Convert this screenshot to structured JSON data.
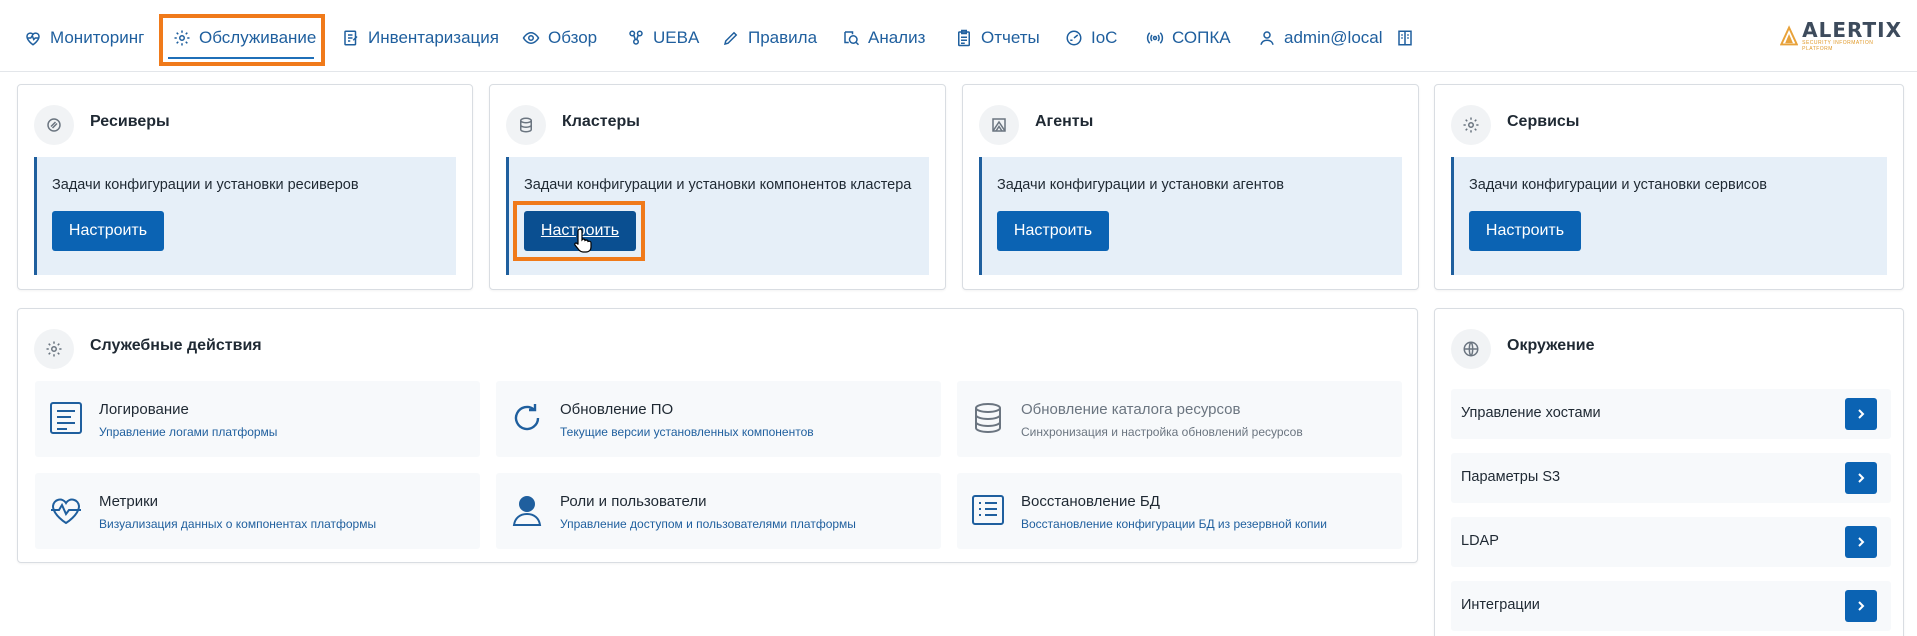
{
  "nav": {
    "items": [
      {
        "label": "Мониторинг",
        "icon": "heart-pulse-icon"
      },
      {
        "label": "Обслуживание",
        "icon": "gear-icon",
        "active": true
      },
      {
        "label": "Инвентаризация",
        "icon": "edit-list-icon"
      },
      {
        "label": "Обзор",
        "icon": "eye-icon"
      },
      {
        "label": "UEBA",
        "icon": "users-network-icon"
      },
      {
        "label": "Правила",
        "icon": "pencil-icon"
      },
      {
        "label": "Анализ",
        "icon": "magnify-analysis-icon"
      },
      {
        "label": "Отчеты",
        "icon": "clipboard-icon"
      },
      {
        "label": "IoC",
        "icon": "shield-gauge-icon"
      },
      {
        "label": "СОПКА",
        "icon": "broadcast-icon"
      },
      {
        "label": "admin@local",
        "icon": "user-icon"
      }
    ],
    "book_icon": "book-icon"
  },
  "logo": {
    "text": "ALERTIX",
    "subtext": "SECURITY INFORMATION PLATFORM",
    "accent": "#e8a23a"
  },
  "top_cards": [
    {
      "title": "Ресиверы",
      "icon": "receiver-icon",
      "description": "Задачи конфигурации и установки ресиверов",
      "button": "Настроить"
    },
    {
      "title": "Кластеры",
      "icon": "database-icon",
      "description": "Задачи конфигурации и установки компонентов кластера",
      "button": "Настроить"
    },
    {
      "title": "Агенты",
      "icon": "agent-icon",
      "description": "Задачи конфигурации и установки агентов",
      "button": "Настроить"
    },
    {
      "title": "Сервисы",
      "icon": "gear-icon",
      "description": "Задачи конфигурации и установки сервисов",
      "button": "Настроить"
    }
  ],
  "service": {
    "title": "Служебные действия",
    "tiles": [
      {
        "title": "Логирование",
        "subtitle": "Управление логами платформы",
        "icon": "log-list-icon"
      },
      {
        "title": "Обновление ПО",
        "subtitle": "Текущие версии установленных компонентов",
        "icon": "refresh-icon"
      },
      {
        "title": "Обновление каталога ресурсов",
        "subtitle": "Синхронизация и настройка обновлений ресурсов",
        "icon": "database-stack-icon",
        "disabled": true
      },
      {
        "title": "Метрики",
        "subtitle": "Визуализация данных о компонентах платформы",
        "icon": "heart-metrics-icon"
      },
      {
        "title": "Роли и пользователи",
        "subtitle": "Управление доступом и пользователями платформы",
        "icon": "user-role-icon"
      },
      {
        "title": "Восстановление БД",
        "subtitle": "Восстановление конфигурации БД из резервной копии",
        "icon": "db-restore-list-icon"
      }
    ]
  },
  "environment": {
    "title": "Окружение",
    "rows": [
      "Управление хостами",
      "Параметры S3",
      "LDAP",
      "Интеграции"
    ]
  },
  "colors": {
    "primary": "#0b63b3",
    "link": "#1f5f9e",
    "highlight": "#f07a1a",
    "panel": "#e6eff8"
  }
}
